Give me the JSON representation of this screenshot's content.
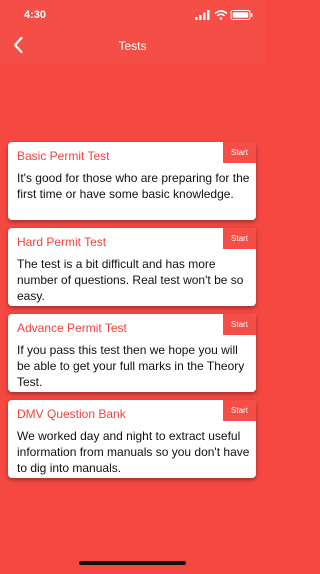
{
  "status_bar": {
    "time": "4:30"
  },
  "nav": {
    "title": "Tests"
  },
  "tests": [
    {
      "title": "Basic Permit Test",
      "start_label": "Start",
      "description": "It's good for those who are preparing for the first time or have some basic knowledge."
    },
    {
      "title": "Hard Permit Test",
      "start_label": "Start",
      "description": "The test is a bit difficult and has more number of questions. Real test won't be so easy."
    },
    {
      "title": "Advance Permit Test",
      "start_label": "Start",
      "description": "If you pass this test then we hope  you will be able to get your full marks in the Theory Test."
    },
    {
      "title": "DMV Question Bank",
      "start_label": "Start",
      "description": "We worked day and night to extract useful information from manuals so you don't have to dig into manuals."
    }
  ],
  "colors": {
    "background": "#f44841",
    "header": "#f44e46",
    "accent": "#f0443e"
  }
}
